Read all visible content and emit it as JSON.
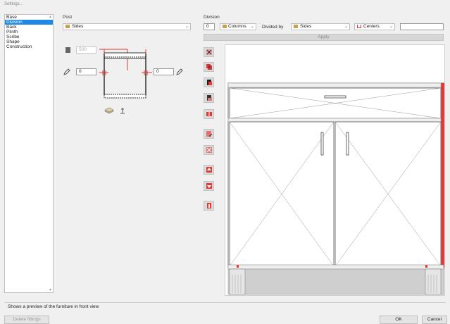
{
  "window": {
    "title": "Settings..."
  },
  "nav": {
    "items": [
      {
        "label": "Base",
        "selected": false
      },
      {
        "label": "Division",
        "selected": true
      },
      {
        "label": "Back",
        "selected": false
      },
      {
        "label": "Plinth",
        "selected": false
      },
      {
        "label": "Scribe",
        "selected": false
      },
      {
        "label": "Shape",
        "selected": false
      },
      {
        "label": "Construction",
        "selected": false
      }
    ]
  },
  "post": {
    "section_label": "Post",
    "select_value": "Sides",
    "height_value": "500",
    "left_offset": "0",
    "right_offset": "0"
  },
  "division": {
    "section_label": "Division",
    "count_value": "0",
    "type_select": "Columns",
    "divided_by_label": "Divided by",
    "divided_by_select": "Sides",
    "position_select": "Centers",
    "extra_value": "",
    "apply_label": "Apply"
  },
  "status": {
    "text": "Shows a preview of the furniture in front view"
  },
  "footer": {
    "delete_label": "Delete fittings",
    "ok_label": "OK",
    "cancel_label": "Cancel"
  },
  "colors": {
    "accent": "#1e88e5",
    "highlight": "#e53935",
    "panel": "#d9d9d9"
  }
}
